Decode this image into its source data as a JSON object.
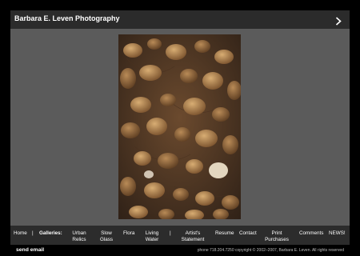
{
  "header": {
    "title": "Barbara E. Leven Photography",
    "next_icon": "chevron-right-icon"
  },
  "photo": {
    "icon": "photo-image",
    "colors": {
      "background": "#3f2d1f",
      "petal_light": "#c59a64",
      "petal_dark": "#7d5632",
      "highlight": "#e9ddc7"
    }
  },
  "nav": {
    "home": "Home",
    "separator_1": "|",
    "galleries": "Galleries:",
    "urban_relics_1": "Urban",
    "urban_relics_2": "Relics",
    "slow_glass_1": "Slow",
    "slow_glass_2": "Glass",
    "flora": "Flora",
    "living_water_1": "Living",
    "living_water_2": "Water",
    "separator_2": "|",
    "artists_statement_1": "Artist's",
    "artists_statement_2": "Statement",
    "resume": "Resume",
    "contact": "Contact",
    "print_purchases_1": "Print",
    "print_purchases_2": "Purchases",
    "comments": "Comments",
    "news": "NEWS!"
  },
  "footer": {
    "send_email": "send email",
    "copyright": "phone 718.204.7250 copyright © 2002–2007, Barbara E. Leven. All rights reserved"
  }
}
